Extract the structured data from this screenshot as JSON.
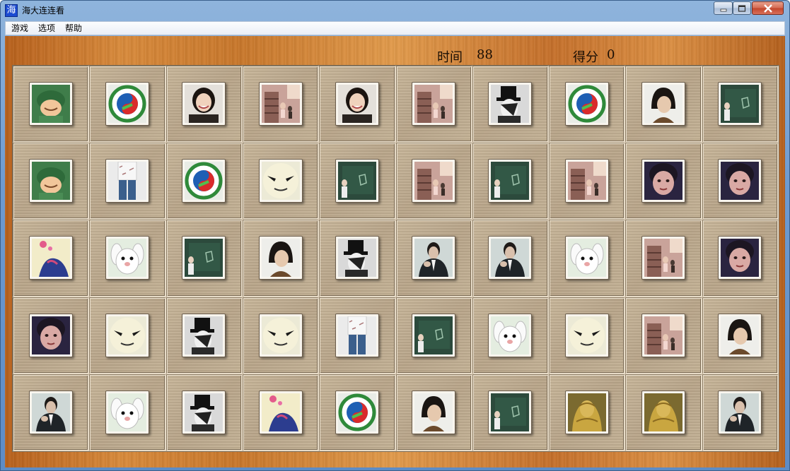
{
  "window": {
    "title": "海大连连看",
    "icon_glyph": "海",
    "controls": [
      "minimize-icon",
      "maximize-icon",
      "close-icon"
    ]
  },
  "menu": {
    "items": [
      {
        "label": "游戏"
      },
      {
        "label": "选项"
      },
      {
        "label": "帮助"
      }
    ]
  },
  "status": {
    "time_label": "时间",
    "time_value": "88",
    "score_label": "得分",
    "score_value": "0"
  },
  "board": {
    "rows": 5,
    "cols": 10,
    "tiles": [
      [
        "soldier",
        "ocean-univ-logo",
        "smiling-woman",
        "girl-stairs",
        "smiling-woman",
        "girl-stairs",
        "top-hat",
        "ocean-univ-logo",
        "short-hair-woman",
        "blackboard-boy"
      ],
      [
        "soldier",
        "jeans-person",
        "ocean-univ-logo",
        "cartoon-face",
        "blackboard-boy",
        "girl-stairs",
        "blackboard-boy",
        "girl-stairs",
        "purple-girl",
        "purple-girl"
      ],
      [
        "colorful-girl",
        "white-rabbit",
        "blackboard-boy",
        "short-hair-woman",
        "top-hat",
        "suit-man",
        "suit-man",
        "white-rabbit",
        "girl-stairs",
        "purple-girl"
      ],
      [
        "purple-girl",
        "cartoon-face",
        "top-hat",
        "cartoon-face",
        "jeans-person",
        "blackboard-boy",
        "white-rabbit",
        "cartoon-face",
        "girl-stairs",
        "short-hair-woman"
      ],
      [
        "suit-man",
        "white-rabbit",
        "top-hat",
        "colorful-girl",
        "ocean-univ-logo",
        "short-hair-woman",
        "blackboard-boy",
        "golden-statue",
        "golden-statue",
        "suit-man"
      ]
    ]
  },
  "colors": {
    "wood": "#d98a3a",
    "cell_bg": "#c0ad90",
    "tile_bg": "#f3efe6"
  }
}
